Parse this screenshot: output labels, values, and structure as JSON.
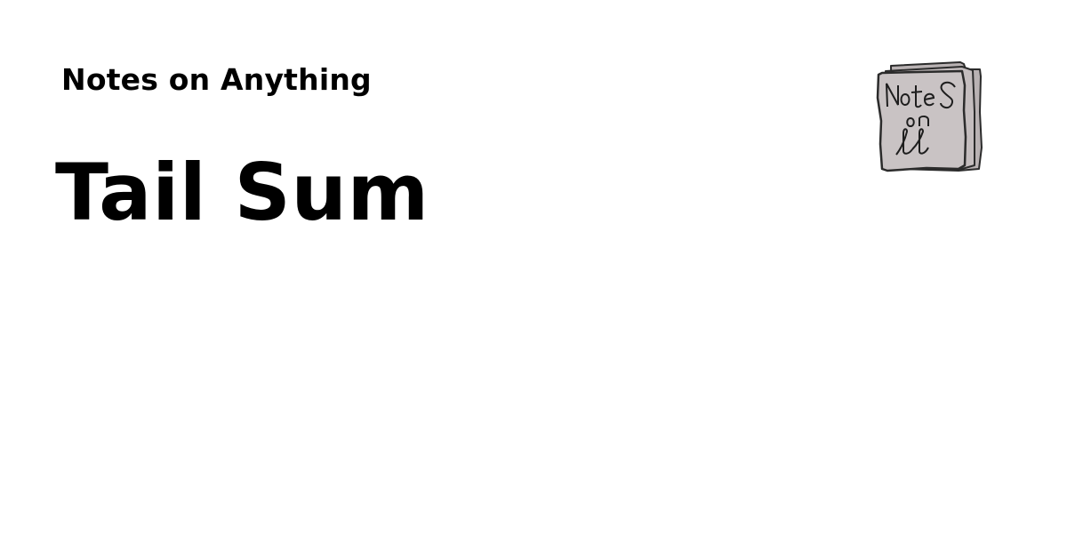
{
  "site": {
    "name": "Notes on Anything"
  },
  "post": {
    "title": "Tail Sum"
  },
  "logo": {
    "icon": "notebook-logo-icon",
    "lettering": "Notes on ll"
  },
  "colors": {
    "background": "#ffffff",
    "text": "#000000",
    "logo_fill": "#c9c3c4",
    "logo_stroke": "#2b2b2b"
  }
}
